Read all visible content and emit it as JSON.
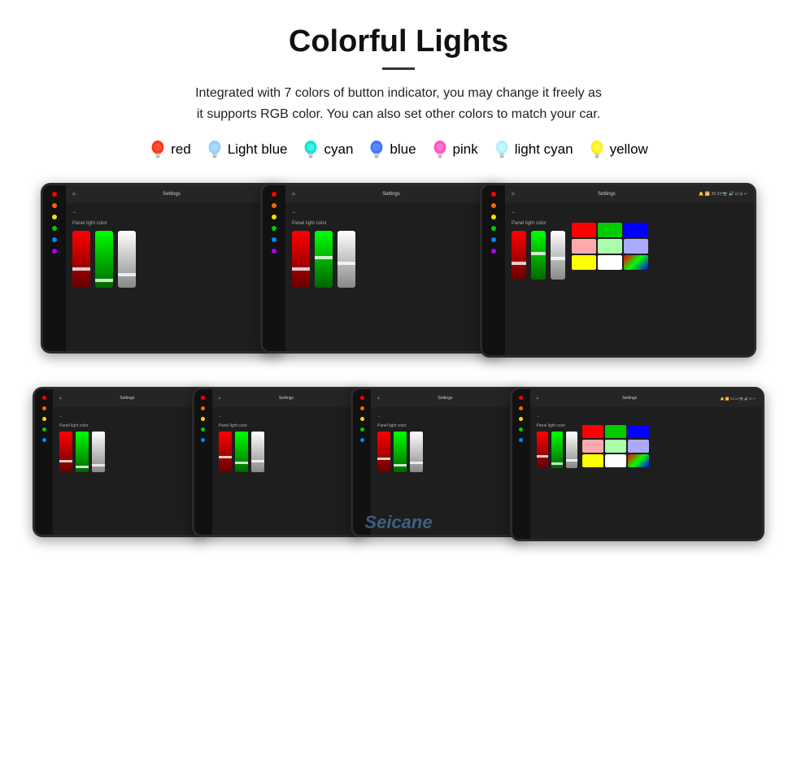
{
  "header": {
    "title": "Colorful Lights",
    "description": "Integrated with 7 colors of button indicator, you may change it freely as\nit supports RGB color. You can also set other colors to match your car."
  },
  "colors": [
    {
      "name": "red",
      "color": "#ff2200",
      "bulb_color": "#ff2200"
    },
    {
      "name": "Light blue",
      "color": "#88ccff",
      "bulb_color": "#88ccff"
    },
    {
      "name": "cyan",
      "color": "#00ffee",
      "bulb_color": "#00ffee"
    },
    {
      "name": "blue",
      "color": "#3366ff",
      "bulb_color": "#3366ff"
    },
    {
      "name": "pink",
      "color": "#ff44bb",
      "bulb_color": "#ff44bb"
    },
    {
      "name": "light cyan",
      "color": "#aaeeff",
      "bulb_color": "#aaeeff"
    },
    {
      "name": "yellow",
      "color": "#ffee00",
      "bulb_color": "#ffee00"
    }
  ],
  "screens": {
    "row1_label": "Panel light color",
    "row2_label": "Panel light color",
    "topbar_title": "Settings",
    "panel_label": "Panel light color"
  },
  "watermark": "Seicane"
}
